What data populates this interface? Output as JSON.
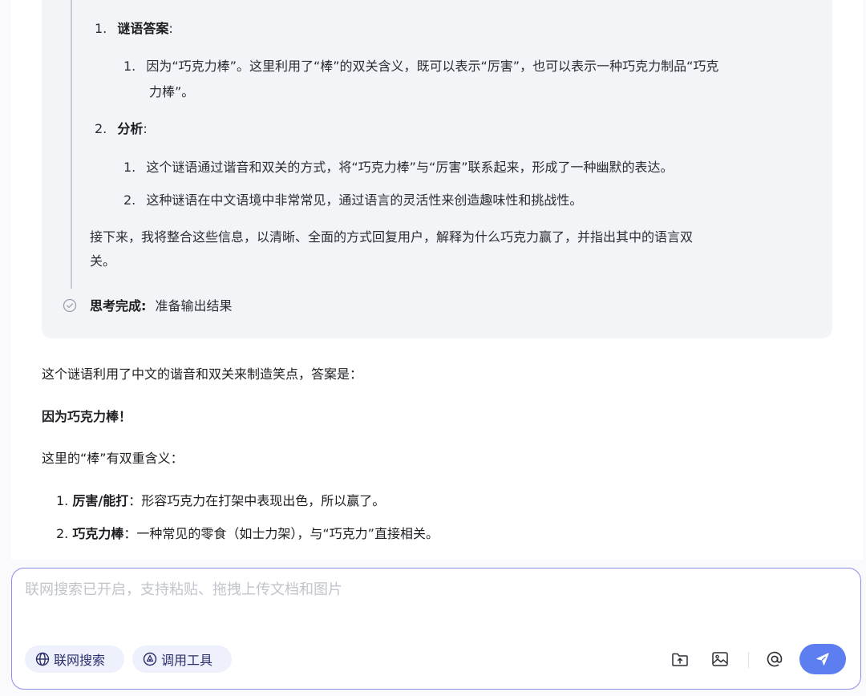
{
  "thinking": {
    "item1_num": "1.",
    "item1_label": "谜语答案",
    "item1_colon": ":",
    "item1_sub1_num": "1.",
    "item1_sub1_line1": "因为“巧克力棒”。这里利用了“棒”的双关含义，既可以表示“厉害”，也可以表示一种巧克力制品“巧克",
    "item1_sub1_line2": "力棒”。",
    "item2_num": "2.",
    "item2_label": "分析",
    "item2_colon": ":",
    "item2_sub1_num": "1.",
    "item2_sub1": "这个谜语通过谐音和双关的方式，将“巧克力棒”与“厉害”联系起来，形成了一种幽默的表达。",
    "item2_sub2_num": "2.",
    "item2_sub2": "这种谜语在中文语境中非常常见，通过语言的灵活性来创造趣味性和挑战性。",
    "next_line1": "接下来，我将整合这些信息，以清晰、全面的方式回复用户，解释为什么巧克力赢了，并指出其中的语言双",
    "next_line2": "关。",
    "done_label": "思考完成:",
    "done_text": "准备输出结果"
  },
  "answer": {
    "intro": "这个谜语利用了中文的谐音和双关来制造笑点，答案是：",
    "answer_bold": "因为巧克力棒！",
    "meaning": "这里的“棒”有双重含义：",
    "list": [
      {
        "num": "1.",
        "term": "厉害/能打",
        "desc": "：形容巧克力在打架中表现出色，所以赢了。"
      },
      {
        "num": "2.",
        "term": "巧克力棒",
        "desc": "：一种常见的零食（如士力架），与“巧克力”直接相关。"
      }
    ]
  },
  "input": {
    "placeholder": "联网搜索已开启，支持粘贴、拖拽上传文档和图片",
    "web_search_label": "联网搜索",
    "tools_label": "调用工具"
  },
  "icons": {
    "check": "check-circle-icon",
    "globe": "globe-icon",
    "tool": "tool-icon",
    "upload": "folder-upload-icon",
    "image": "image-icon",
    "mention": "at-icon",
    "send": "send-icon"
  },
  "colors": {
    "accent": "#5d7ef0",
    "input_border": "#8b8fe8",
    "pill_bg": "#eef0fb",
    "thinking_bg": "#f3f4f8"
  }
}
